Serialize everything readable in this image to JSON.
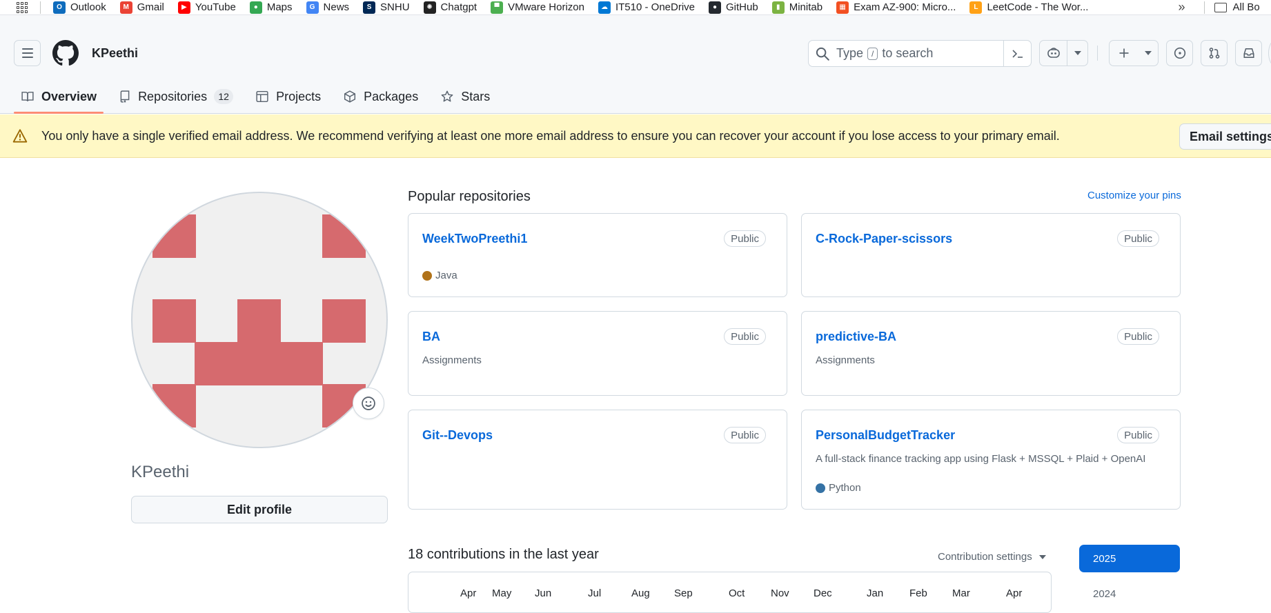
{
  "bookmarks": {
    "items": [
      {
        "label": "Outlook",
        "icon": "outlook-icon",
        "color": "#0f6cbd",
        "glyph": "O"
      },
      {
        "label": "Gmail",
        "icon": "gmail-icon",
        "color": "#ea4335",
        "glyph": "M"
      },
      {
        "label": "YouTube",
        "icon": "youtube-icon",
        "color": "#ff0000",
        "glyph": "▶"
      },
      {
        "label": "Maps",
        "icon": "maps-icon",
        "color": "#34a853",
        "glyph": "●"
      },
      {
        "label": "News",
        "icon": "news-icon",
        "color": "#4285f4",
        "glyph": "G"
      },
      {
        "label": "SNHU",
        "icon": "snhu-icon",
        "color": "#002855",
        "glyph": "S"
      },
      {
        "label": "Chatgpt",
        "icon": "chatgpt-icon",
        "color": "#222222",
        "glyph": "✺"
      },
      {
        "label": "VMware Horizon",
        "icon": "vmware-icon",
        "color": "#4caf50",
        "glyph": "▀"
      },
      {
        "label": "IT510 - OneDrive",
        "icon": "onedrive-icon",
        "color": "#0078d4",
        "glyph": "☁"
      },
      {
        "label": "GitHub",
        "icon": "github-icon",
        "color": "#24292f",
        "glyph": "●"
      },
      {
        "label": "Minitab",
        "icon": "minitab-icon",
        "color": "#7cb342",
        "glyph": "▮"
      },
      {
        "label": "Exam AZ-900: Micro...",
        "icon": "microsoft-icon",
        "color": "#f25022",
        "glyph": "▦"
      },
      {
        "label": "LeetCode - The Wor...",
        "icon": "leetcode-icon",
        "color": "#ffa116",
        "glyph": "L"
      }
    ],
    "more_glyph": "»",
    "all_label": "All Bo"
  },
  "header": {
    "username": "KPeethi",
    "search_prefix": "Type",
    "search_key": "/",
    "search_suffix": "to search"
  },
  "tabs": [
    {
      "label": "Overview",
      "icon": "book-icon",
      "active": true
    },
    {
      "label": "Repositories",
      "icon": "repo-icon",
      "count": "12"
    },
    {
      "label": "Projects",
      "icon": "table-icon"
    },
    {
      "label": "Packages",
      "icon": "package-icon"
    },
    {
      "label": "Stars",
      "icon": "star-icon"
    }
  ],
  "banner": {
    "text": "You only have a single verified email address. We recommend verifying at least one more email address to ensure you can recover your account if you lose access to your primary email.",
    "button_label": "Email settings"
  },
  "profile": {
    "name": "KPeethi",
    "edit_label": "Edit profile"
  },
  "popular": {
    "title": "Popular repositories",
    "customize_label": "Customize your pins",
    "repos": [
      {
        "name": "WeekTwoPreethi1",
        "visibility": "Public",
        "description": "",
        "language": "Java",
        "lang_color": "#b07219"
      },
      {
        "name": "C-Rock-Paper-scissors",
        "visibility": "Public",
        "description": "",
        "language": "",
        "lang_color": ""
      },
      {
        "name": "BA",
        "visibility": "Public",
        "description": "Assignments",
        "language": "",
        "lang_color": ""
      },
      {
        "name": "predictive-BA",
        "visibility": "Public",
        "description": "Assignments",
        "language": "",
        "lang_color": ""
      },
      {
        "name": "Git--Devops",
        "visibility": "Public",
        "description": "",
        "language": "",
        "lang_color": ""
      },
      {
        "name": "PersonalBudgetTracker",
        "visibility": "Public",
        "description": "A full-stack finance tracking app using Flask + MSSQL + Plaid + OpenAI",
        "language": "Python",
        "lang_color": "#3572A5"
      }
    ]
  },
  "contributions": {
    "title": "18 contributions in the last year",
    "settings_label": "Contribution settings",
    "months": [
      "Apr",
      "May",
      "Jun",
      "Jul",
      "Aug",
      "Sep",
      "Oct",
      "Nov",
      "Dec",
      "Jan",
      "Feb",
      "Mar",
      "Apr"
    ],
    "years": [
      "2025",
      "2024"
    ]
  },
  "colors": {
    "accent": "#0969da",
    "tab_underline": "#fd8c73",
    "banner_bg": "#fff8c5",
    "avatar_pixel": "#d66a6e"
  }
}
